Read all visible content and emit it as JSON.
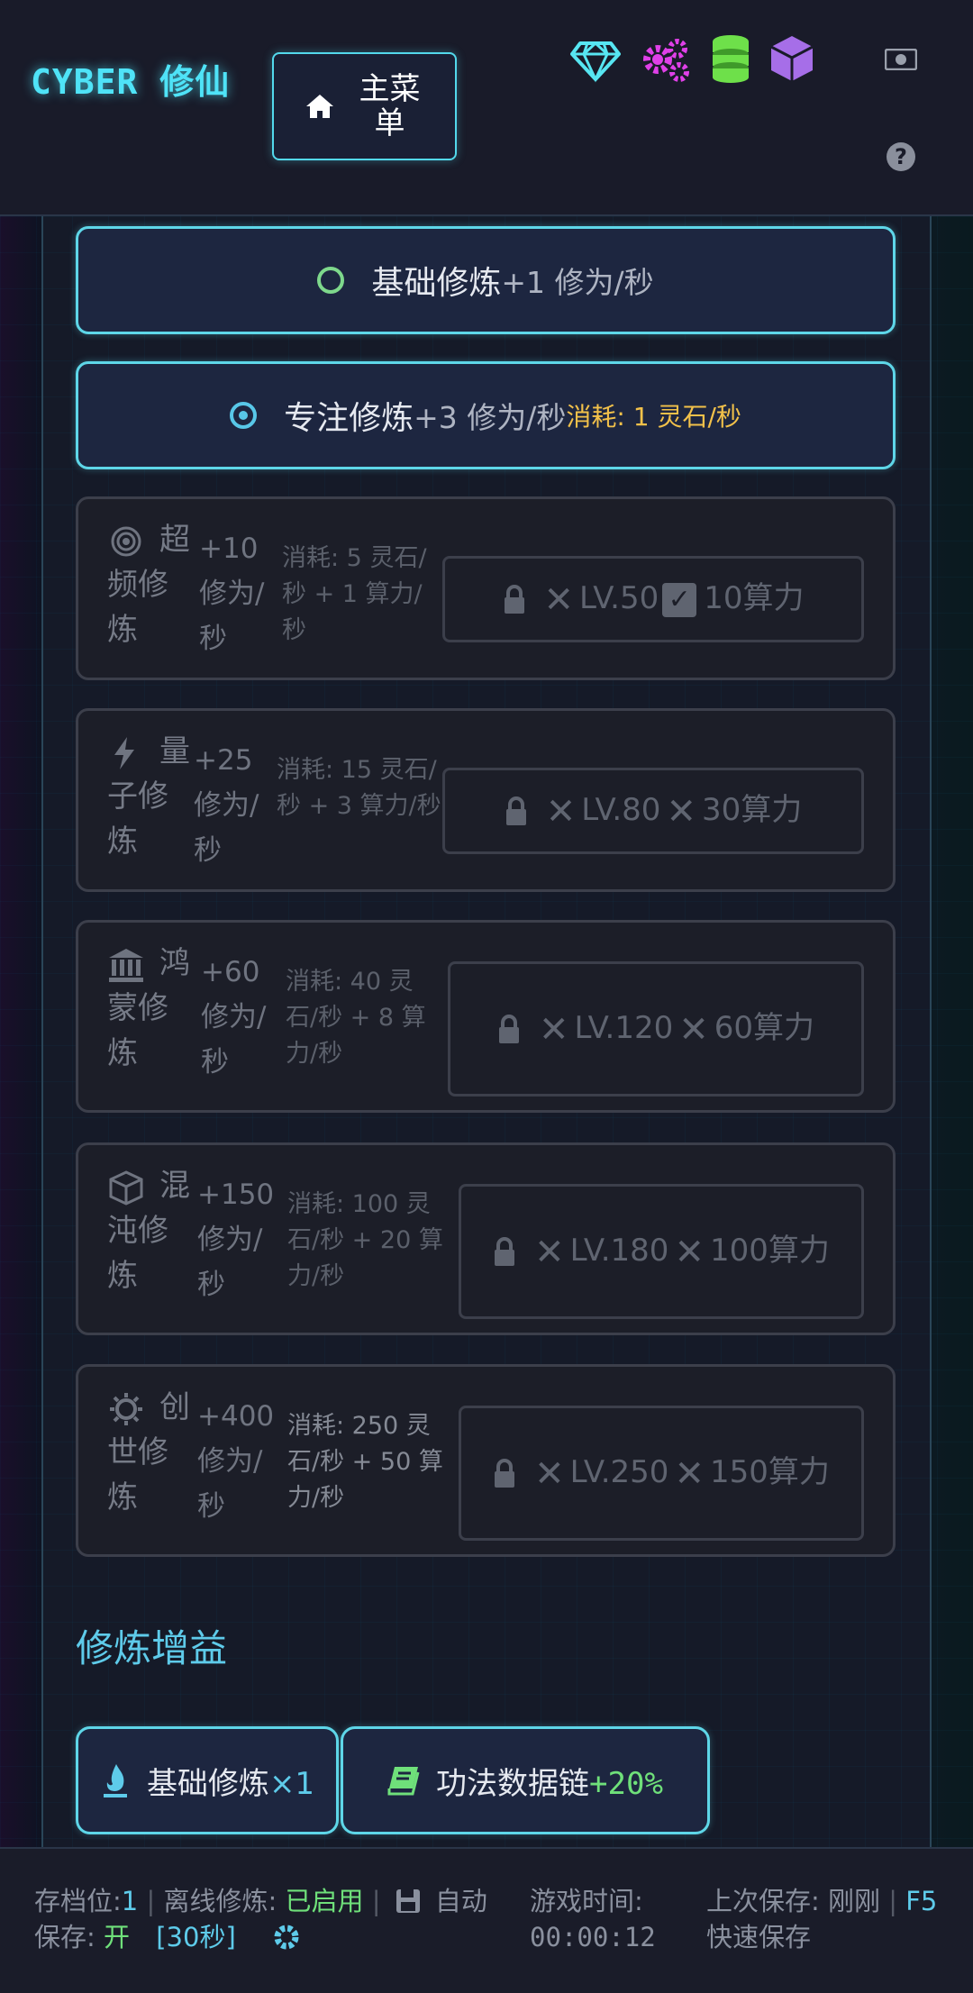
{
  "header": {
    "brand": "CYBER 修仙",
    "menu_label": "主菜单",
    "resource_icons": [
      "diamond-icon",
      "gears-icon",
      "coins-stack-icon",
      "cube-icon"
    ],
    "colors": {
      "diamond": "#57e6f2",
      "gears": "#e040e8",
      "coins": "#6ee04a",
      "cube": "#a66ee8"
    }
  },
  "modes_active": [
    {
      "name": "基础修炼",
      "rate": "+1 修为/秒",
      "cost": ""
    },
    {
      "name": "专注修炼",
      "rate": "+3 修为/秒",
      "cost": "消耗: 1 灵石/秒"
    }
  ],
  "modes_locked": [
    {
      "icon": "target-icon",
      "name": "超频修炼",
      "rate": "+10 修为/秒",
      "cost": "消耗: 5 灵石/秒 + 1 算力/秒",
      "req_level": "LV.50",
      "req_compute": "10算力",
      "compute_met": true
    },
    {
      "icon": "bolt-icon",
      "name": "量子修炼",
      "rate": "+25 修为/秒",
      "cost": "消耗: 15 灵石/秒 + 3 算力/秒",
      "req_level": "LV.80",
      "req_compute": "30算力",
      "compute_met": false
    },
    {
      "icon": "temple-icon",
      "name": "鸿蒙修炼",
      "rate": "+60 修为/秒",
      "cost": "消耗: 40 灵石/秒 + 8 算力/秒",
      "req_level": "LV.120",
      "req_compute": "60算力",
      "compute_met": false
    },
    {
      "icon": "box-icon",
      "name": "混沌修炼",
      "rate": "+150 修为/秒",
      "cost": "消耗: 100 灵石/秒 + 20 算力/秒",
      "req_level": "LV.180",
      "req_compute": "100算力",
      "compute_met": false
    },
    {
      "icon": "sun-icon",
      "name": "创世修炼",
      "rate": "+400 修为/秒",
      "cost": "消耗: 250 灵石/秒 + 50 算力/秒",
      "req_level": "LV.250",
      "req_compute": "150算力",
      "compute_met": false
    }
  ],
  "buffs_title": "修炼增益",
  "buffs": [
    {
      "icon": "flame-icon",
      "name": "基础修炼",
      "value": "×1"
    },
    {
      "icon": "book-icon",
      "name": "功法数据链",
      "value": "+20%"
    }
  ],
  "footer": {
    "slot_label": "存档位:",
    "slot_value": "1",
    "offline_label": "离线修炼:",
    "offline_value": "已启用",
    "autosave_label": "自动保存:",
    "autosave_value": "开",
    "autosave_interval": "[30秒]",
    "time_label": "游戏时间:",
    "time_value": "00:00:12",
    "last_save_label": "上次保存:",
    "last_save_value": "刚刚",
    "quicksave_key": "F5",
    "quicksave_label": "快速保存"
  }
}
